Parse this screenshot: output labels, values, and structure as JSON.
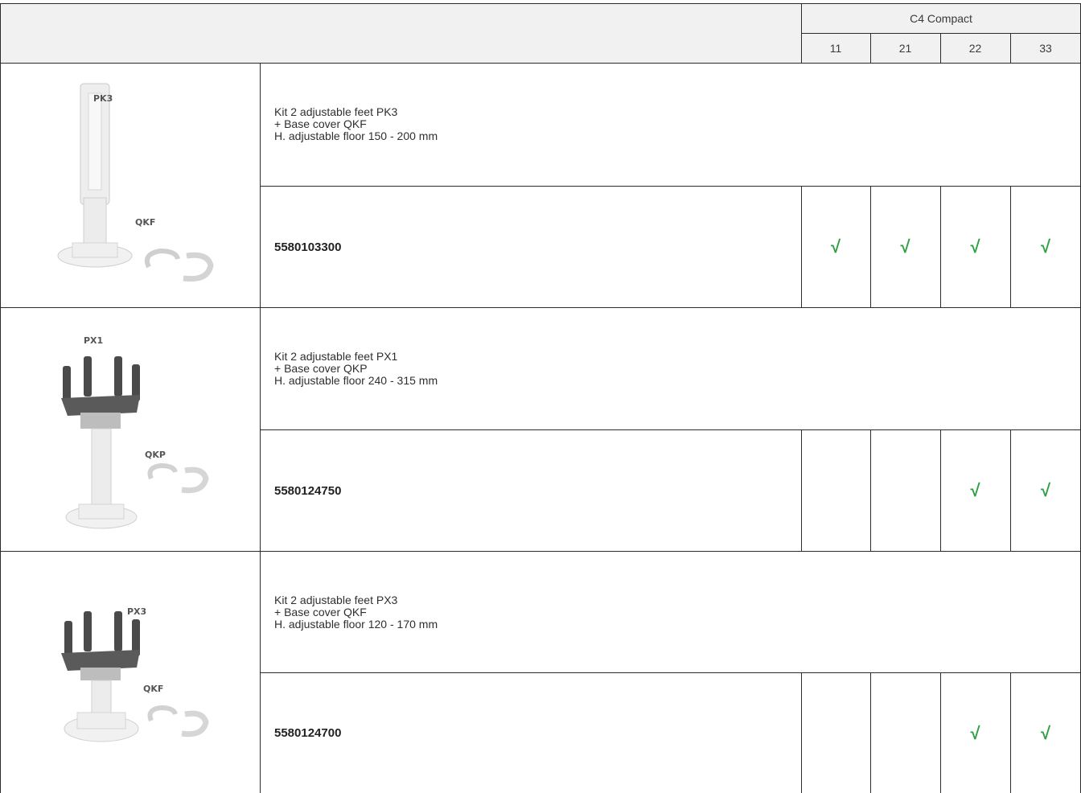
{
  "header": {
    "series": "C4 Compact",
    "columns": [
      "11",
      "21",
      "22",
      "33"
    ]
  },
  "rows": [
    {
      "image_labels": [
        "PK3",
        "QKF"
      ],
      "description": [
        "Kit 2 adjustable feet PK3",
        "+ Base cover QKF",
        "H. adjustable floor 150 - 200 mm"
      ],
      "code": "5580103300",
      "checks": [
        "√",
        "√",
        "√",
        "√"
      ]
    },
    {
      "image_labels": [
        "PX1",
        "QKP"
      ],
      "description": [
        "Kit 2 adjustable feet PX1",
        "+ Base cover QKP",
        "H. adjustable floor 240 - 315 mm"
      ],
      "code": "5580124750",
      "checks": [
        "",
        "",
        "√",
        "√"
      ]
    },
    {
      "image_labels": [
        "PX3",
        "QKF"
      ],
      "description": [
        "Kit 2 adjustable feet PX3",
        "+ Base cover QKF",
        "H. adjustable floor 120 - 170 mm"
      ],
      "code": "5580124700",
      "checks": [
        "",
        "",
        "√",
        "√"
      ]
    }
  ],
  "colors": {
    "check": "#2ea043",
    "header_bg": "#f1f1f1",
    "border": "#2b2b2b"
  }
}
